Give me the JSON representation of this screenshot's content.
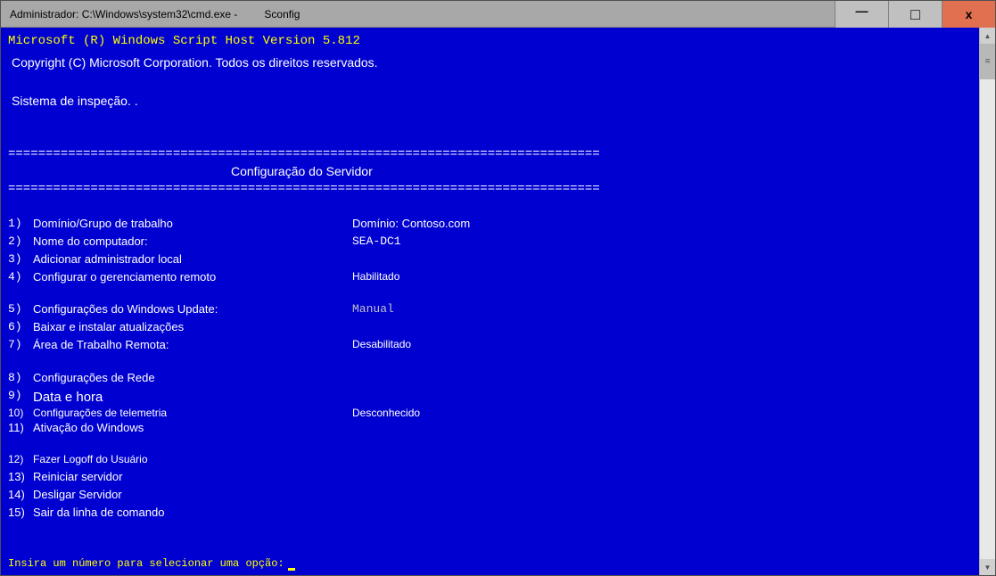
{
  "titlebar": {
    "part1": "Administrador: C:\\Windows\\system32\\cmd.exe -",
    "part2": "Sconfig"
  },
  "header": {
    "script_host": "Microsoft (R) Windows Script Host Version 5.812",
    "copyright": "Copyright (C) Microsoft Corporation. Todos os direitos reservados.",
    "inspect": "Sistema de inspeção.   ."
  },
  "divider": "===============================================================================",
  "section_title": "Configuração do Servidor",
  "menu": [
    {
      "num": "1)",
      "label": "Domínio/Grupo de trabalho",
      "value": "Domínio: Contoso.com",
      "value_style": "sans"
    },
    {
      "num": "2)",
      "label": "Nome do computador:",
      "value": "SEA-DC1",
      "value_style": "mono"
    },
    {
      "num": "3)",
      "label": "Adicionar administrador local",
      "value": "",
      "value_style": ""
    },
    {
      "num": "4)",
      "label": "Configurar o gerenciamento remoto",
      "value": "Habilitado",
      "value_style": "sans-small"
    },
    {
      "num": "",
      "label": "",
      "value": "",
      "spacer": true
    },
    {
      "num": "5)",
      "label": "Configurações do Windows Update:",
      "value": "Manual",
      "value_style": "mono-gray"
    },
    {
      "num": "6)",
      "label": "Baixar e instalar atualizações",
      "value": "",
      "value_style": ""
    },
    {
      "num": "7)",
      "label": "Área de Trabalho Remota:",
      "value": "Desabilitado",
      "value_style": "sans-small"
    },
    {
      "num": "",
      "label": "",
      "value": "",
      "spacer": true
    },
    {
      "num": "8)",
      "label": "Configurações de Rede",
      "value": "",
      "value_style": ""
    },
    {
      "num": "9)",
      "label": "Data e hora",
      "value": "",
      "value_style": "",
      "bold": true
    },
    {
      "num": "10)",
      "label": "Configurações de telemetria",
      "value": "Desconhecido",
      "value_style": "sans-small",
      "tight": true
    },
    {
      "num": "11)",
      "label": "Ativação do Windows",
      "value": "",
      "value_style": ""
    },
    {
      "num": "",
      "label": "",
      "value": "",
      "spacer": true
    },
    {
      "num": "12)",
      "label": "Fazer Logoff do Usuário",
      "value": "",
      "value_style": "",
      "small": true
    },
    {
      "num": "13)",
      "label": "Reiniciar servidor",
      "value": "",
      "value_style": ""
    },
    {
      "num": "14)",
      "label": "Desligar Servidor",
      "value": "",
      "value_style": ""
    },
    {
      "num": "15)",
      "label": "Sair da linha de comando",
      "value": "",
      "value_style": ""
    }
  ],
  "prompt": "Insira um número para selecionar uma opção:"
}
